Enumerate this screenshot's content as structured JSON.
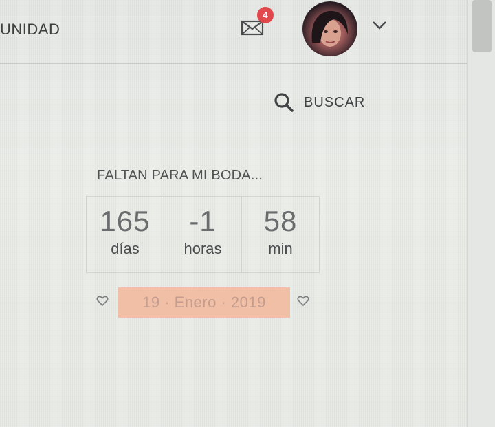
{
  "header": {
    "nav_label": "UNIDAD",
    "notification_count": "4",
    "mail_icon": "envelope-icon",
    "avatar_icon": "user-avatar",
    "menu_icon": "chevron-down-icon"
  },
  "search": {
    "label": "BUSCAR",
    "icon": "search-icon"
  },
  "countdown": {
    "title": "FALTAN PARA MI BODA...",
    "items": [
      {
        "value": "165",
        "unit": "días"
      },
      {
        "value": "-1",
        "unit": "horas"
      },
      {
        "value": "58",
        "unit": "min"
      }
    ],
    "date": "19 · Enero · 2019",
    "date_icon": "heart-icon"
  },
  "colors": {
    "badge": "#e0484c",
    "date_highlight": "#f0bfa6"
  }
}
